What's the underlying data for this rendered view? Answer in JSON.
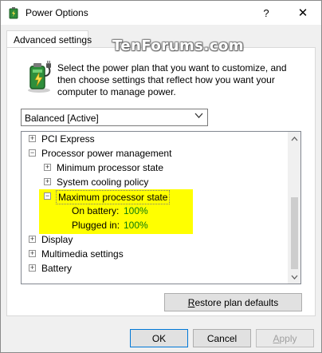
{
  "window": {
    "title": "Power Options",
    "help_label": "?",
    "close_label": "✕"
  },
  "watermark": "TenForums.com",
  "tabs": [
    {
      "label": "Advanced settings",
      "active": true
    }
  ],
  "description": "Select the power plan that you want to customize, and then choose settings that reflect how you want your computer to manage power.",
  "plan_select": {
    "value": "Balanced [Active]"
  },
  "tree": {
    "items": [
      {
        "label": "PCI Express",
        "expander": "+"
      },
      {
        "label": "Processor power management",
        "expander": "−"
      },
      {
        "label": "Minimum processor state",
        "expander": "+"
      },
      {
        "label": "System cooling policy",
        "expander": "+"
      },
      {
        "label": "Maximum processor state",
        "expander": "−"
      },
      {
        "label": "On battery:",
        "value": "100%"
      },
      {
        "label": "Plugged in:",
        "value": "100%"
      },
      {
        "label": "Display",
        "expander": "+"
      },
      {
        "label": "Multimedia settings",
        "expander": "+"
      },
      {
        "label": "Battery",
        "expander": "+"
      }
    ]
  },
  "buttons": {
    "restore_prefix": "",
    "restore_underline": "R",
    "restore_rest": "estore plan defaults",
    "ok": "OK",
    "cancel": "Cancel",
    "apply_underline": "A",
    "apply_rest": "pply"
  },
  "colors": {
    "highlight": "#ffff00",
    "value_green": "#0a7a0a",
    "ok_border": "#0078d7"
  }
}
